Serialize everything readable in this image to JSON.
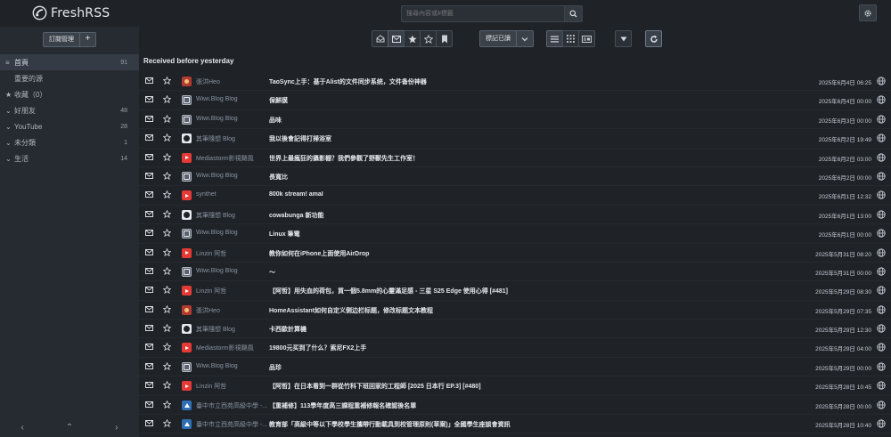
{
  "app": {
    "name": "FreshRSS"
  },
  "search": {
    "placeholder": "搜尋內容或#標籤"
  },
  "sidebar": {
    "manage_label": "訂閱管理",
    "add_label": "+",
    "items": [
      {
        "icon": "list-icon",
        "glyph": "≡",
        "label": "首頁",
        "count": "91",
        "active": true
      },
      {
        "icon": "important-icon",
        "glyph": "",
        "label": "重要的源",
        "count": "",
        "active": false
      },
      {
        "icon": "star-icon",
        "glyph": "★",
        "label": "收藏（0）",
        "count": "",
        "active": false
      },
      {
        "icon": "chevron-down-icon",
        "glyph": "⌄",
        "label": "好朋友",
        "count": "48",
        "active": false
      },
      {
        "icon": "chevron-down-icon",
        "glyph": "⌄",
        "label": "YouTube",
        "count": "28",
        "active": false
      },
      {
        "icon": "chevron-down-icon",
        "glyph": "⌄",
        "label": "未分類",
        "count": "1",
        "active": false
      },
      {
        "icon": "chevron-down-icon",
        "glyph": "⌄",
        "label": "生活",
        "count": "14",
        "active": false
      }
    ],
    "pager": {
      "prev": "‹",
      "up": "⌃",
      "next": "›"
    }
  },
  "toolbar": {
    "mark_read_label": "標記已讀"
  },
  "stream": {
    "section_title": "Received before yesterday",
    "articles": [
      {
        "fav": "heo",
        "feed": "張洪Heo",
        "title": "TaoSync上手：基于Alist的文件同步系统，文件备份神器",
        "date": "2025年6月4日 06:25"
      },
      {
        "fav": "rss",
        "feed": "Wiwi.Blog Blog",
        "title": "保鮮膜",
        "date": "2025年6月4日 00:00"
      },
      {
        "fav": "rss",
        "feed": "Wiwi.Blog Blog",
        "title": "品味",
        "date": "2025年6月3日 00:00"
      },
      {
        "fav": "circle",
        "feed": "其筆隨想 Blog",
        "title": "我以後會記得打掃浴室",
        "date": "2025年6月2日 19:49"
      },
      {
        "fav": "yt",
        "feed": "Mediastorm影視颶風",
        "title": "世界上最瘋狂的攝影棚？我們參觀了野獸先生工作室！",
        "date": "2025年6月2日 03:00"
      },
      {
        "fav": "rss",
        "feed": "Wiwi.Blog Blog",
        "title": "長寬比",
        "date": "2025年6月2日 00:00"
      },
      {
        "fav": "yt",
        "feed": "synthet",
        "title": "800k stream! amal",
        "date": "2025年6月1日 12:32"
      },
      {
        "fav": "circle",
        "feed": "其筆隨想 Blog",
        "title": "cowabunga 新功能",
        "date": "2025年6月1日 13:00"
      },
      {
        "fav": "rss",
        "feed": "Wiwi.Blog Blog",
        "title": "Linux 筆電",
        "date": "2025年6月1日 00:00"
      },
      {
        "fav": "yt",
        "feed": "Linzin 阿哲",
        "title": "教你如何在iPhone上面使用AirDrop",
        "date": "2025年5月31日 08:20"
      },
      {
        "fav": "rss",
        "feed": "Wiwi.Blog Blog",
        "title": "～",
        "date": "2025年5月31日 00:00"
      },
      {
        "fav": "yt",
        "feed": "Linzin 阿哲",
        "title": "【阿哲】用失血的荷包，買一個5.8mm的心靈滿足感 - 三星 S25 Edge 使用心得 [#481]",
        "date": "2025年5月29日 08:30"
      },
      {
        "fav": "heo",
        "feed": "張洪Heo",
        "title": "HomeAssistant如何自定义侧边栏标题，修改标题文本教程",
        "date": "2025年5月29日 07:35"
      },
      {
        "fav": "circle",
        "feed": "其筆隨想 Blog",
        "title": "卡西歐計算機",
        "date": "2025年5月29日 12:30"
      },
      {
        "fav": "yt",
        "feed": "Mediastorm影視颶風",
        "title": "19800元买到了什么？索尼FX2上手",
        "date": "2025年5月29日 04:00"
      },
      {
        "fav": "rss",
        "feed": "Wiwi.Blog Blog",
        "title": "品珍",
        "date": "2025年5月29日 00:00"
      },
      {
        "fav": "yt",
        "feed": "Linzin 阿哲",
        "title": "【阿哲】在日本看到一群從竹科下班回家的工程師 [2025 日本行 EP.3] [#480]",
        "date": "2025年5月28日 10:45"
      },
      {
        "fav": "school",
        "feed": "臺中市立西苑高級中學 -...",
        "title": "【重補修】113學年度高三課程重補修報名確認後名單",
        "date": "2025年5月28日 00:00"
      },
      {
        "fav": "school",
        "feed": "臺中市立西苑高級中學 -...",
        "title": "教育部「高級中等以下學校學生攜帶行動載具到校管理原則(草案)」全國學生座談會資訊",
        "date": "2025年5月28日 10:40"
      }
    ]
  }
}
